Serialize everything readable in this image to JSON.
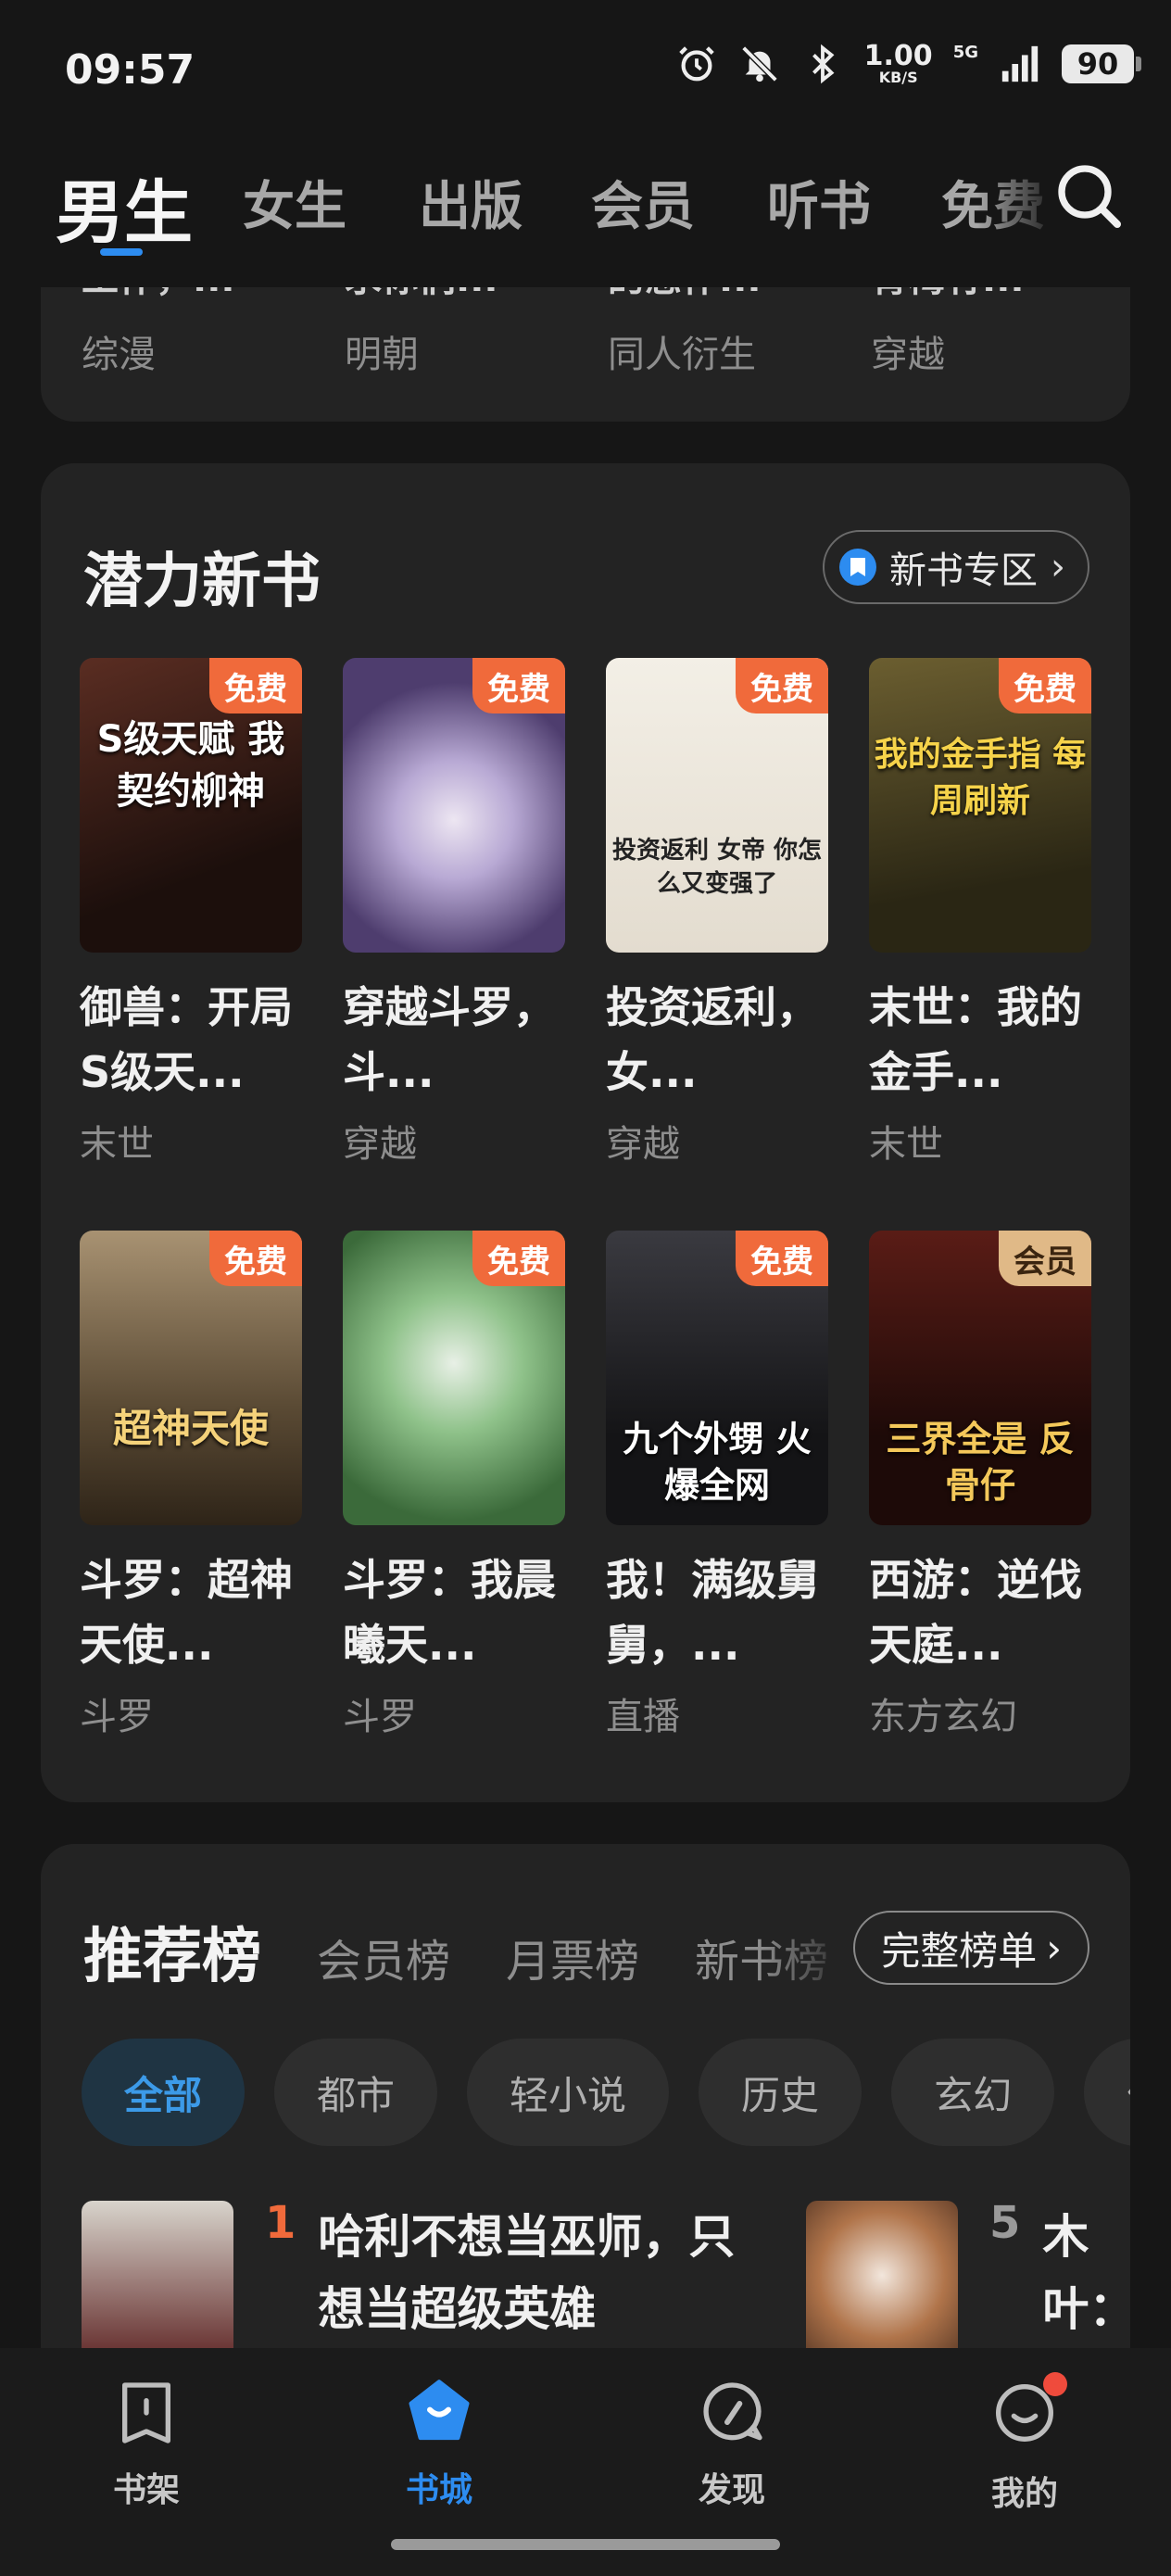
{
  "status_bar": {
    "time": "09:57",
    "speed_value": "1.00",
    "speed_unit": "KB/S",
    "network": "5G",
    "battery": "90"
  },
  "top_tabs": [
    "男生",
    "女生",
    "出版",
    "会员",
    "听书",
    "免费"
  ],
  "previous_row": {
    "peek_titles": [
      "工作，...",
      "求你们...",
      "的恶作...",
      "青梅竹..."
    ],
    "categories": [
      "综漫",
      "明朝",
      "同人衍生",
      "穿越"
    ]
  },
  "new_books": {
    "title": "潜力新书",
    "zone_button": "新书专区",
    "books": [
      {
        "title": "御兽：开局S级天...",
        "category": "末世",
        "badge": "免费",
        "cover_text": "S级天赋 我契约柳神",
        "cover_color": "#3a1d16"
      },
      {
        "title": "穿越斗罗，斗...",
        "category": "穿越",
        "badge": "免费",
        "cover_text": "",
        "cover_color": "#5a4a7a"
      },
      {
        "title": "投资返利，女...",
        "category": "穿越",
        "badge": "免费",
        "cover_text": "投资返利 女帝 你怎么又变强了",
        "cover_color": "#e8e2d8"
      },
      {
        "title": "末世：我的金手...",
        "category": "末世",
        "badge": "免费",
        "cover_text": "我的金手指 每周刷新",
        "cover_color": "#3d3620"
      },
      {
        "title": "斗罗：超神天使...",
        "category": "斗罗",
        "badge": "免费",
        "cover_text": "超神天使",
        "cover_color": "#6e5a3e"
      },
      {
        "title": "斗罗：我晨曦天...",
        "category": "斗罗",
        "badge": "免费",
        "cover_text": "",
        "cover_color": "#4f7a4a"
      },
      {
        "title": "我！满级舅舅，...",
        "category": "直播",
        "badge": "免费",
        "cover_text": "九个外甥 火爆全网",
        "cover_color": "#1f1f22"
      },
      {
        "title": "西游：逆伐天庭...",
        "category": "东方玄幻",
        "badge": "会员",
        "cover_text": "三界全是 反骨仔",
        "cover_color": "#3a1414"
      }
    ]
  },
  "ranking": {
    "title": "推荐榜",
    "tabs": [
      "会员榜",
      "月票榜",
      "新书榜"
    ],
    "full_button": "完整榜单",
    "chips": [
      "全部",
      "都市",
      "轻小说",
      "历史",
      "玄幻",
      "仙侠"
    ],
    "items": [
      {
        "rank": "1",
        "title": "哈利不想当巫师，只想当超级英雄",
        "rank_color": "#f06a3b"
      },
      {
        "rank": "5",
        "title": "木叶：开局灭",
        "rank_color": "#9a9a9a"
      }
    ]
  },
  "bottom_nav": [
    "书架",
    "书城",
    "发现",
    "我的"
  ],
  "colors": {
    "accent": "#2d8cf0",
    "free_badge": "#f06a3b",
    "vip_badge": "#e0b987",
    "background": "#161616",
    "card": "#232323"
  }
}
